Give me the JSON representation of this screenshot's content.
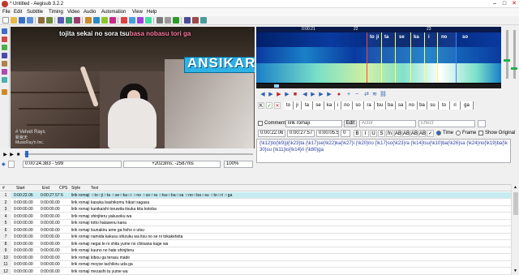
{
  "window": {
    "title": "* Untitled - Aegisub 3.2.2",
    "minimize": "–",
    "maximize": "□",
    "close": "✕"
  },
  "menu": [
    "File",
    "Edit",
    "Subtitle",
    "Timing",
    "Video",
    "Audio",
    "Automation",
    "View",
    "Help"
  ],
  "video": {
    "karaoke_sung": "tojita sekai no sora tsu",
    "karaoke_unsung": "basa nobasu tori ga",
    "logo": "ANSIKARA",
    "caption_title": "# Velvet Rays",
    "caption_jp": "新宮天",
    "caption_label": "MusicRay'n Inc.",
    "time": "0:00:24.383 - 599",
    "offset": "+2023ms; -2587ms",
    "zoom": "100%"
  },
  "audio": {
    "time_labels": [
      "0:00:21",
      "22",
      "23"
    ],
    "syllables_top": [
      "to",
      "ji",
      "ta",
      "se",
      "ka",
      "i",
      "no",
      "so"
    ],
    "syllables_strip": [
      "to",
      "ji",
      "ta",
      "se",
      "ka",
      "i",
      "no",
      "so",
      "ra",
      "tsu",
      "ba",
      "sa",
      "no",
      "ba",
      "su",
      "to",
      "ri",
      "ga"
    ]
  },
  "edit": {
    "comment_label": "Comment",
    "style": "lirik romaji",
    "edit_btn": "Edit",
    "actor_placeholder": "Actor",
    "effect_placeholder": "Effect",
    "layer": "0",
    "start": "0:00:22.06",
    "end": "0:00:27.57",
    "duration": "0:00:05.51",
    "margin_l": "0",
    "margin_r": "0",
    "margin_v": "0",
    "time_label": "Time",
    "frame_label": "Frame",
    "show_original": "Show Original",
    "fmt_buttons": [
      "B",
      "I",
      "U",
      "S",
      "fn",
      "AB",
      "AB",
      "AB",
      "AB",
      "✓"
    ],
    "text": "{\\k12}to{\\k9}ji{\\k23}ta {\\k17}se{\\k22}ka{\\k27}i {\\k20}no {\\k17}so{\\k23}ra {\\k14}tsu{\\k10}ba{\\k26}sa {\\k24}no{\\k19}ba{\\k30}su {\\k11}to{\\k14}ri {\\k80}ga"
  },
  "grid": {
    "headers": [
      "#",
      "Start",
      "End",
      "CPS",
      "Style",
      "Text"
    ],
    "rows": [
      {
        "n": "1",
        "start": "0:00:22.06",
        "end": "0:00:27.57",
        "cps": "6",
        "style": "lirik romaji",
        "text": "☆to☆ji☆ta ☆se☆ka☆i ☆no ☆so☆ra ☆tsu☆ba☆sa ☆no☆ba☆su ☆to☆ri ☆ga"
      },
      {
        "n": "2",
        "start": "0:00:00.00",
        "end": "0:00:00.00",
        "cps": "",
        "style": "lirik romaji",
        "text": "kasuka bashikomu hikari sagasu"
      },
      {
        "n": "3",
        "start": "0:00:00.00",
        "end": "0:00:00.00",
        "cps": "",
        "style": "lirik romaji",
        "text": "kunikaishi toruwita itsuka kita kotoba"
      },
      {
        "n": "4",
        "start": "0:00:00.00",
        "end": "0:00:00.00",
        "cps": "",
        "style": "lirik romaji",
        "text": "shinjiteru yakusoku wa"
      },
      {
        "n": "5",
        "start": "0:00:00.00",
        "end": "0:00:00.00",
        "cps": "",
        "style": "lirik romaji",
        "text": "totto hatasenu kana"
      },
      {
        "n": "6",
        "start": "0:00:00.00",
        "end": "0:00:00.00",
        "cps": "",
        "style": "lirik romaji",
        "text": "tsunakiru ame ga hoho o utsu"
      },
      {
        "n": "7",
        "start": "0:00:00.00",
        "end": "0:00:00.00",
        "cps": "",
        "style": "lirik romaji",
        "text": "namida kakusu shizuku wa itsu no se ni tokaketeita"
      },
      {
        "n": "8",
        "start": "0:00:00.00",
        "end": "0:00:00.00",
        "cps": "",
        "style": "lirik romaji",
        "text": "negai te ni shita yume no chiisana kage wa"
      },
      {
        "n": "9",
        "start": "0:00:00.00",
        "end": "0:00:00.00",
        "cps": "",
        "style": "lirik romaji",
        "text": "kuuno no hate shinjiteru"
      },
      {
        "n": "10",
        "start": "0:00:00.00",
        "end": "0:00:00.00",
        "cps": "",
        "style": "lirik romaji",
        "text": "kibou ga terasu made"
      },
      {
        "n": "11",
        "start": "0:00:00.00",
        "end": "0:00:00.00",
        "cps": "",
        "style": "lirik romaji",
        "text": "moyoe tachikiru uda ga"
      },
      {
        "n": "12",
        "start": "0:00:00.00",
        "end": "0:00:00.00",
        "cps": "",
        "style": "lirik romaji",
        "text": "mezashi ta yume wa"
      }
    ]
  }
}
